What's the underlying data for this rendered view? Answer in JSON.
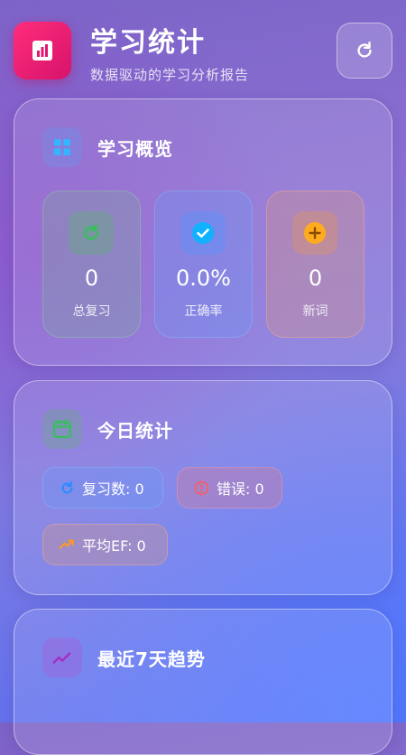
{
  "header": {
    "title": "学习统计",
    "subtitle": "数据驱动的学习分析报告",
    "logo_icon": "bar-chart-icon",
    "refresh_icon": "refresh-icon"
  },
  "overview": {
    "title": "学习概览",
    "icon": "grid-icon",
    "stats": [
      {
        "value": "0",
        "label": "总复习",
        "icon": "refresh-icon",
        "color": "#4caf50"
      },
      {
        "value": "0.0%",
        "label": "正确率",
        "icon": "check-circle-icon",
        "color": "#2196f3"
      },
      {
        "value": "0",
        "label": "新词",
        "icon": "plus-circle-icon",
        "color": "#ff9800"
      }
    ]
  },
  "today": {
    "title": "今日统计",
    "icon": "calendar-icon",
    "chips": [
      {
        "text": "复习数: 0",
        "icon": "refresh-icon",
        "color": "#2196f3"
      },
      {
        "text": "错误: 0",
        "icon": "alert-circle-icon",
        "color": "#f44336"
      },
      {
        "text": "平均EF: 0",
        "icon": "trending-up-icon",
        "color": "#ff9800"
      }
    ]
  },
  "trend": {
    "title": "最近7天趋势",
    "icon": "trend-line-icon",
    "color": "#9c27b0"
  }
}
